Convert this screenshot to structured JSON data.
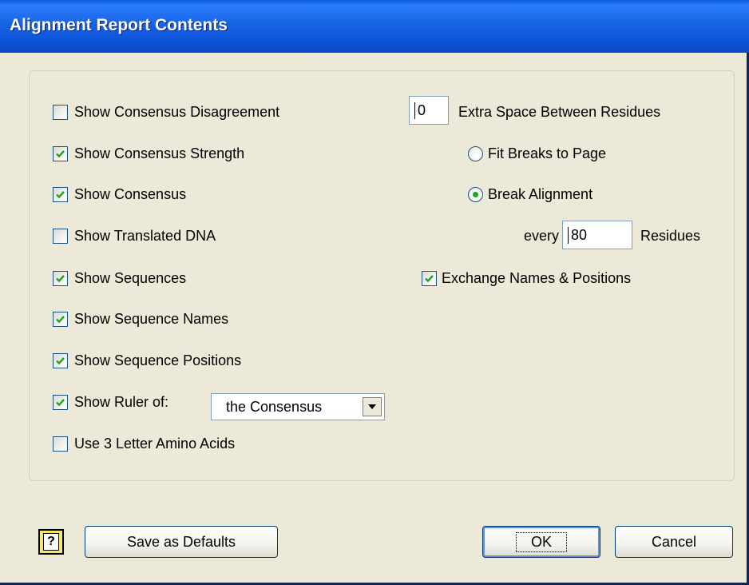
{
  "window": {
    "title": "Alignment Report Contents"
  },
  "left_options": [
    {
      "label": "Show Consensus Disagreement",
      "checked": false
    },
    {
      "label": "Show Consensus Strength",
      "checked": true
    },
    {
      "label": "Show Consensus",
      "checked": true
    },
    {
      "label": "Show Translated DNA",
      "checked": false
    },
    {
      "label": "Show Sequences",
      "checked": true
    },
    {
      "label": "Show Sequence Names",
      "checked": true
    },
    {
      "label": "Show Sequence Positions",
      "checked": true
    },
    {
      "label": "Show Ruler of:",
      "checked": true
    },
    {
      "label": "Use 3 Letter Amino Acids",
      "checked": false
    }
  ],
  "ruler_select": {
    "value": "the Consensus"
  },
  "extra_space": {
    "value": "0",
    "label": "Extra Space Between Residues"
  },
  "break_options": [
    {
      "label": "Fit Breaks to Page",
      "selected": false
    },
    {
      "label": "Break Alignment",
      "selected": true
    }
  ],
  "break_every": {
    "prefix": "every",
    "value": "80",
    "suffix": "Residues"
  },
  "exchange": {
    "label": "Exchange Names & Positions",
    "checked": true
  },
  "buttons": {
    "help": "?",
    "save_defaults": "Save as Defaults",
    "ok": "OK",
    "cancel": "Cancel"
  },
  "colors": {
    "check": "#21a121",
    "title_bar": "#0c52d8",
    "dialog_bg": "#ece9d8"
  }
}
